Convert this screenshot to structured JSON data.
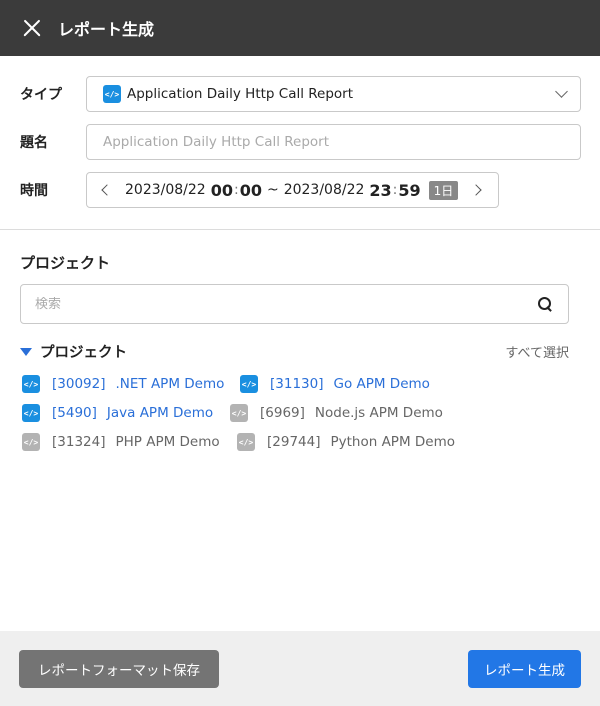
{
  "header": {
    "title": "レポート生成"
  },
  "form": {
    "type": {
      "label": "タイプ",
      "value": "Application Daily Http Call Report"
    },
    "subject": {
      "label": "題名",
      "placeholder": "Application Daily Http Call Report"
    },
    "time": {
      "label": "時間",
      "start_date": "2023/08/22",
      "start_hour": "00",
      "start_minute": "00",
      "tilde": "~",
      "end_date": "2023/08/22",
      "end_hour": "23",
      "end_minute": "59",
      "range": "1日"
    }
  },
  "projects_section": {
    "title": "プロジェクト",
    "search_placeholder": "検索",
    "group_name": "プロジェクト",
    "select_all": "すべて選択",
    "items": [
      {
        "id": "[30092]",
        "name": ".NET APM Demo",
        "selected": true
      },
      {
        "id": "[31130]",
        "name": "Go APM Demo",
        "selected": true
      },
      {
        "id": "[5490]",
        "name": "Java APM Demo",
        "selected": true
      },
      {
        "id": "[6969]",
        "name": "Node.js APM Demo",
        "selected": false
      },
      {
        "id": "[31324]",
        "name": "PHP APM Demo",
        "selected": false
      },
      {
        "id": "[29744]",
        "name": "Python APM Demo",
        "selected": false
      }
    ]
  },
  "footer": {
    "save_format_label": "レポートフォーマット保存",
    "generate_label": "レポート生成"
  },
  "colors": {
    "header": "#3b3b3b",
    "accent": "#2277e6",
    "link": "#2a6fd8",
    "icon_on": "#1a8fe0",
    "icon_off": "#b3b3b3"
  }
}
